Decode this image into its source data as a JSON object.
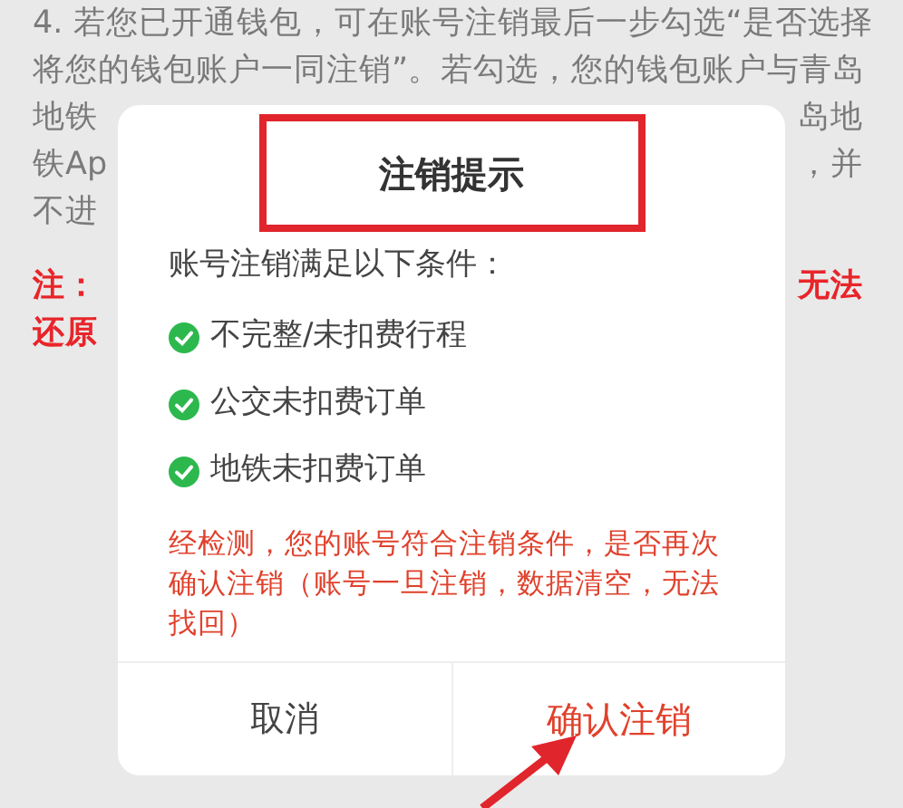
{
  "background_text": [
    {
      "kind": "normal",
      "left": "4. 若您已开通钱包，可在账号注销最后一步勾选“是否选择"
    },
    {
      "kind": "normal",
      "left": "将您的钱包账户一同注销”。若勾选，您的钱包账户与青岛"
    },
    {
      "kind": "normal",
      "left": "地铁",
      "right": "岛地"
    },
    {
      "kind": "normal",
      "left": "铁Ap",
      "right": "，并"
    },
    {
      "kind": "normal",
      "left": "不进"
    },
    {
      "kind": "note",
      "left": "注：",
      "right": "无法"
    },
    {
      "kind": "note",
      "left": "还原"
    }
  ],
  "dialog": {
    "title": "注销提示",
    "intro": "账号注销满足以下条件：",
    "conditions": [
      {
        "label": "不完整/未扣费行程",
        "checked": true
      },
      {
        "label": "公交未扣费订单",
        "checked": true
      },
      {
        "label": "地铁未扣费订单",
        "checked": true
      }
    ],
    "warning": "经检测，您的账号符合注销条件，是否再次确认注销（账号一旦注销，数据清空，无法找回）",
    "buttons": [
      {
        "label": "取消",
        "kind": "cancel"
      },
      {
        "label": "确认注销",
        "kind": "confirm"
      }
    ]
  }
}
